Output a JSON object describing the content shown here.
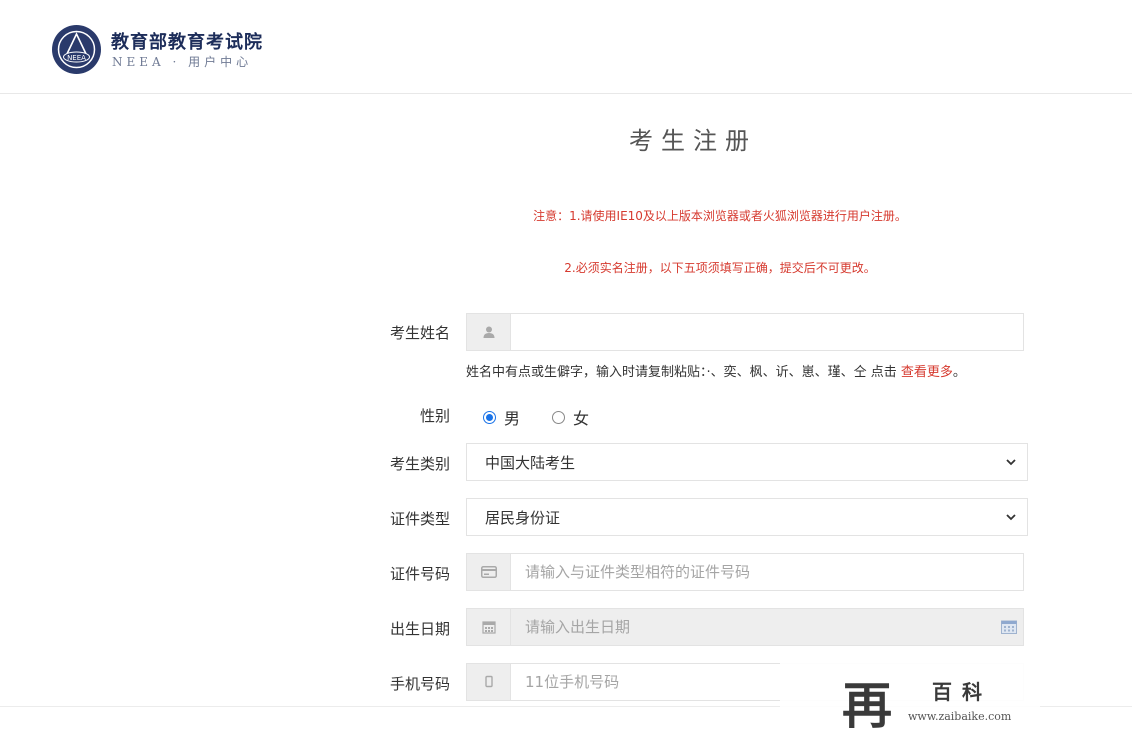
{
  "header": {
    "brand_title": "教育部教育考试院",
    "brand_sub": "NEEA · 用户中心",
    "logo_text": "NEEA"
  },
  "page": {
    "title": "考生注册"
  },
  "notices": {
    "line1": "注意：1.请使用IE10及以上版本浏览器或者火狐浏览器进行用户注册。",
    "line2": "2.必须实名注册，以下五项须填写正确，提交后不可更改。"
  },
  "form": {
    "name": {
      "label": "考生姓名",
      "value": "",
      "placeholder": "",
      "icon": "user-icon"
    },
    "name_hint": {
      "text": "姓名中有点或生僻字，输入时请复制粘贴：·、奕、枫、䜣、崽、瑾、仝 点击 ",
      "link": "查看更多",
      "suffix": "。"
    },
    "gender": {
      "label": "性别",
      "options": [
        "男",
        "女"
      ],
      "selected": "男"
    },
    "candidate_type": {
      "label": "考生类别",
      "value": "中国大陆考生"
    },
    "id_type": {
      "label": "证件类型",
      "value": "居民身份证"
    },
    "id_number": {
      "label": "证件号码",
      "value": "",
      "placeholder": "请输入与证件类型相符的证件号码",
      "icon": "id-card-icon"
    },
    "birth_date": {
      "label": "出生日期",
      "value": "",
      "placeholder": "请输入出生日期",
      "icon": "calendar-icon"
    },
    "phone": {
      "label": "手机号码",
      "value": "",
      "placeholder": "11位手机号码",
      "icon": "mobile-icon"
    }
  },
  "watermark": {
    "glyph": "再",
    "name": "百科",
    "url": "www.zaibaike.com"
  },
  "colors": {
    "notice_red": "#d63a2f",
    "radio_blue": "#1a73e8",
    "brand_navy": "#1d2d5a",
    "addon_gray": "#eeeeee"
  }
}
